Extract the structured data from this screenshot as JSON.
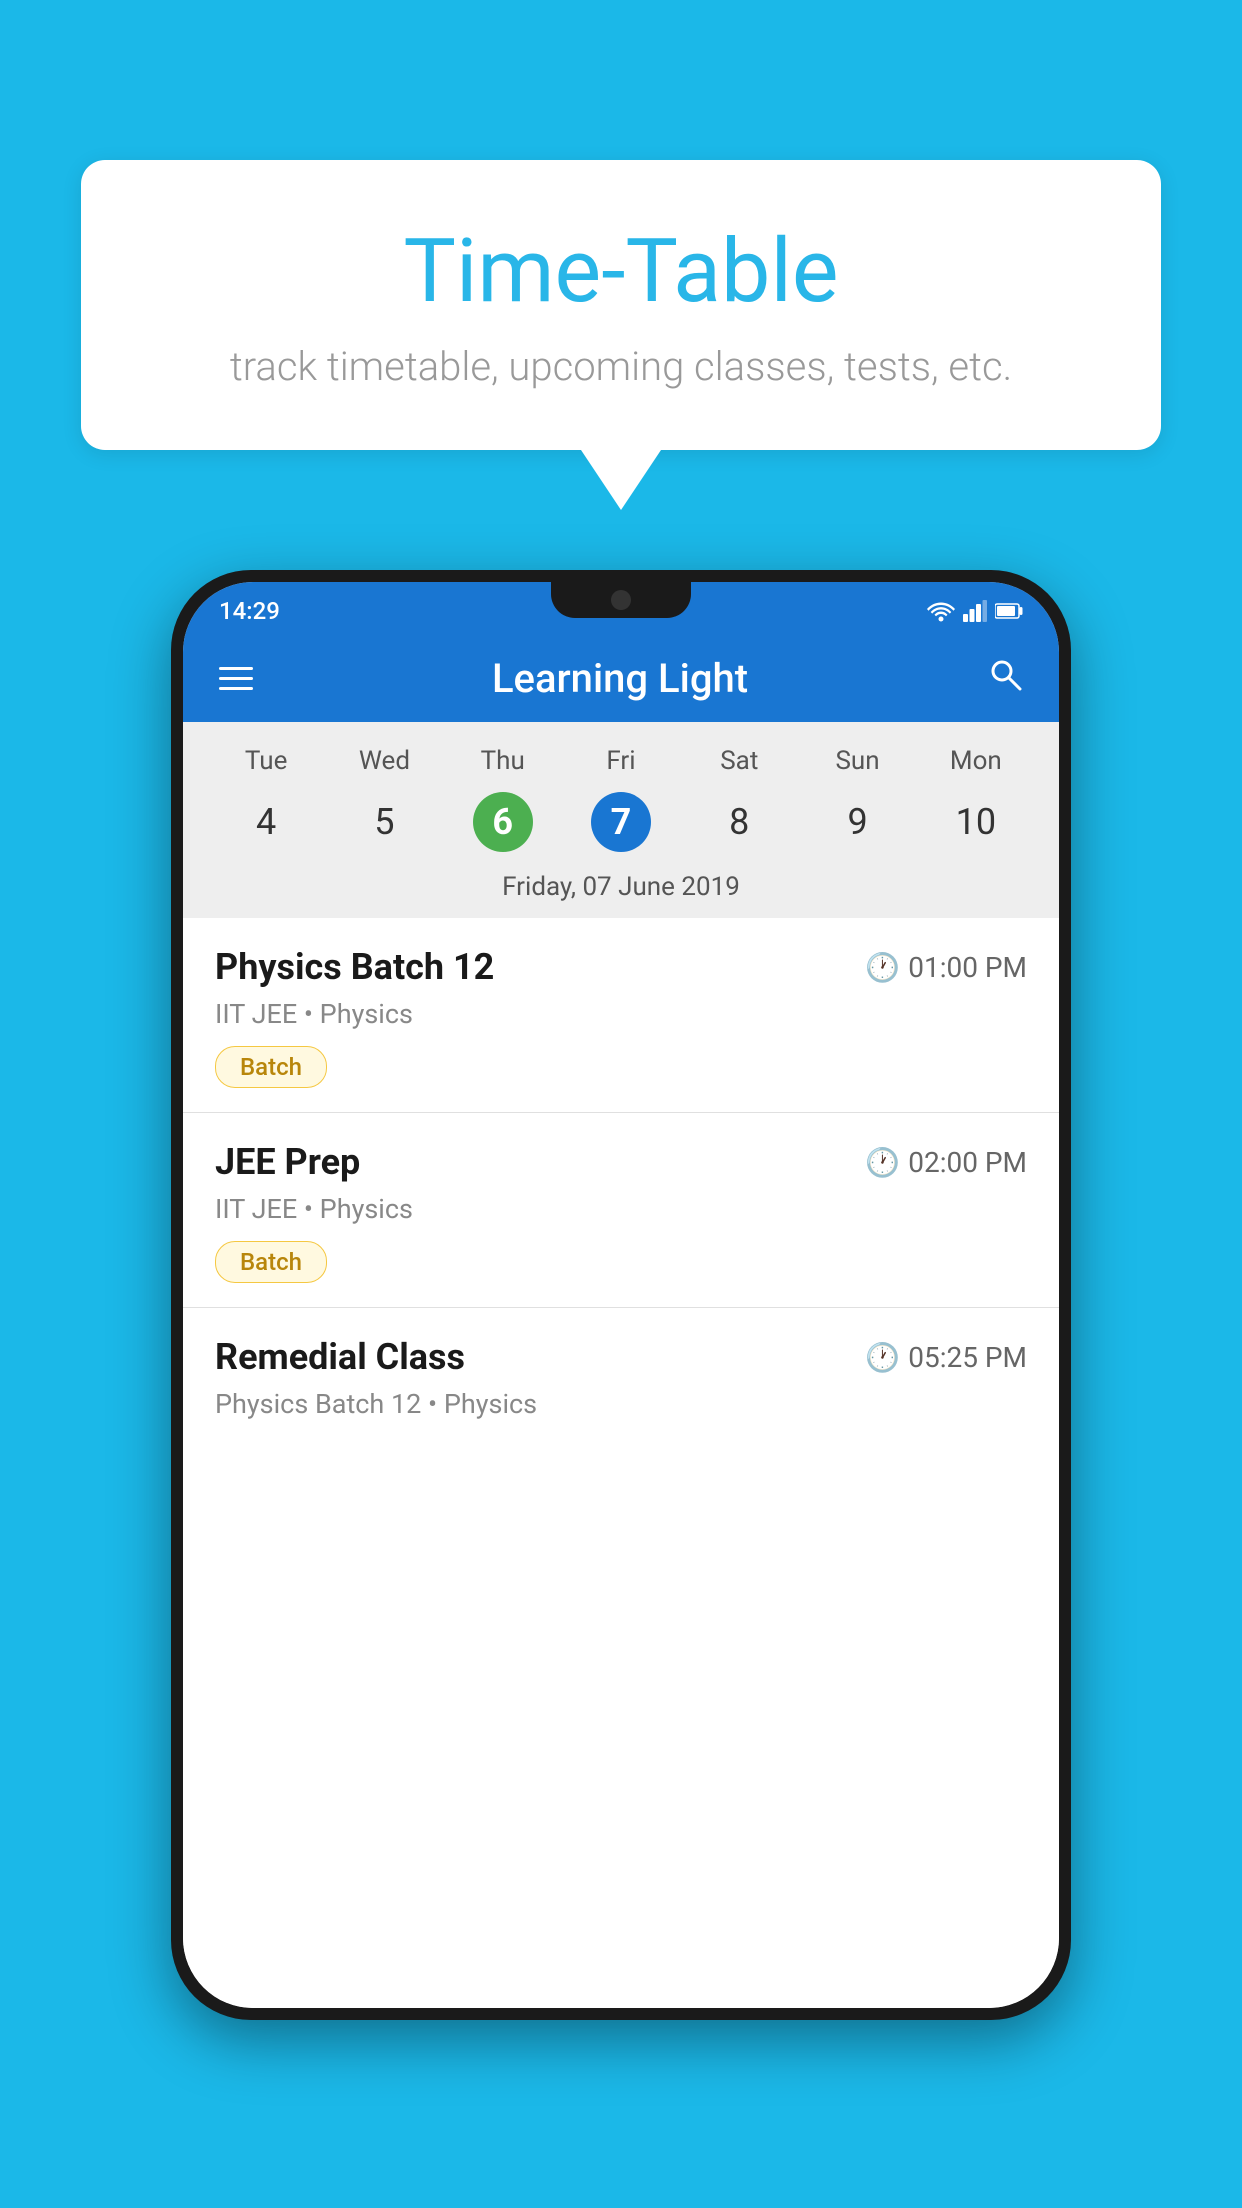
{
  "page": {
    "background_color": "#1BB8E8"
  },
  "speech_bubble": {
    "title": "Time-Table",
    "subtitle": "track timetable, upcoming classes, tests, etc."
  },
  "phone": {
    "status_bar": {
      "time": "14:29",
      "icons": [
        "wifi",
        "signal",
        "battery"
      ]
    },
    "app_bar": {
      "title": "Learning Light",
      "menu_icon": "hamburger",
      "search_icon": "search"
    },
    "calendar": {
      "days": [
        "Tue",
        "Wed",
        "Thu",
        "Fri",
        "Sat",
        "Sun",
        "Mon"
      ],
      "dates": [
        "4",
        "5",
        "6",
        "7",
        "8",
        "9",
        "10"
      ],
      "today_index": 2,
      "selected_index": 3,
      "selected_date_label": "Friday, 07 June 2019"
    },
    "schedule": [
      {
        "title": "Physics Batch 12",
        "time": "01:00 PM",
        "subtitle": "IIT JEE • Physics",
        "tag": "Batch"
      },
      {
        "title": "JEE Prep",
        "time": "02:00 PM",
        "subtitle": "IIT JEE • Physics",
        "tag": "Batch"
      },
      {
        "title": "Remedial Class",
        "time": "05:25 PM",
        "subtitle": "Physics Batch 12 • Physics",
        "tag": ""
      }
    ]
  }
}
